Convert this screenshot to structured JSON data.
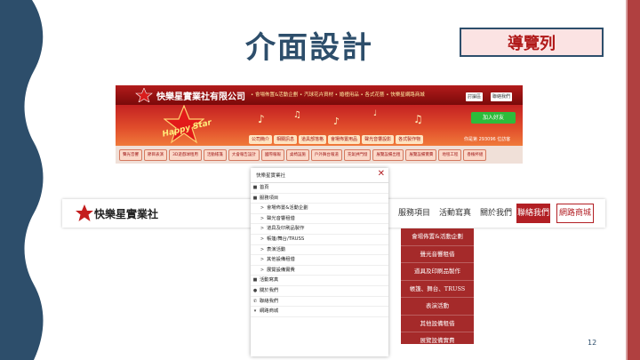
{
  "slide": {
    "title": "介面設計",
    "tag": "導覽列",
    "page_number": "12",
    "colors": {
      "title": "#2d4e6b",
      "accent": "#b21f24",
      "deco_blue": "#2d4e6b"
    }
  },
  "old_site": {
    "company_name": "快樂星實業社有限公司",
    "top_links": "• 會場佈置&活動企劃 • 汽球花卉資材 • 婚禮用品 • 各式花藝 • 快樂星網路商城",
    "top_buttons": [
      "討論區",
      "聯絡我們"
    ],
    "happy_star_text": "Happy Star",
    "line_button": "加入好友",
    "nav": [
      "公司簡介",
      "相關訊息",
      "道具部落格",
      "會場佈置用品",
      "聲光音響設影",
      "各式製作物"
    ],
    "visitor_count": "你是第 293096 位訪客",
    "tags": [
      "聲光音響",
      "節目表演",
      "3D遊戲球租用",
      "活動帳篷",
      "大會報告設計",
      "國際報報",
      "桌椅設施",
      "戶外舞台報道",
      "充氣拱門燈",
      "展覽設備出租",
      "展覽設備實費",
      "地毯工程",
      "香檳杯組"
    ]
  },
  "new_header": {
    "logo_text": "快樂星實業社",
    "nav": [
      "服務項目",
      "活動寫真",
      "關於我們"
    ],
    "contact": "聯絡我們",
    "shop": "網路商城"
  },
  "dropdown_items": [
    "會場佈置&活動企劃",
    "聲光音響租借",
    "道具及印刷品製作",
    "帳篷、舞台、TRUSS",
    "表演活動",
    "其他設備租借",
    "展覽設備實費"
  ],
  "mobile_menu": {
    "logo_text": "快樂星實業社",
    "close": "✕",
    "items": [
      {
        "icon": "■",
        "label": "首頁",
        "level": 0
      },
      {
        "icon": "■",
        "label": "服務項目",
        "level": 0
      },
      {
        "icon": ">",
        "label": "會場佈置&活動企劃",
        "level": 1
      },
      {
        "icon": ">",
        "label": "聲光音響租借",
        "level": 1
      },
      {
        "icon": ">",
        "label": "道具及印刷品製作",
        "level": 1
      },
      {
        "icon": ">",
        "label": "帳篷/舞台/TRUSS",
        "level": 1
      },
      {
        "icon": ">",
        "label": "表演活動",
        "level": 1
      },
      {
        "icon": ">",
        "label": "其他設備租借",
        "level": 1
      },
      {
        "icon": ">",
        "label": "展覽設備實費",
        "level": 1
      },
      {
        "icon": "■",
        "label": "活動寫真",
        "level": 0
      },
      {
        "icon": "●",
        "label": "關於我們",
        "level": 0
      },
      {
        "icon": "✆",
        "label": "聯絡我們",
        "level": 0
      },
      {
        "icon": "▾",
        "label": "網路商城",
        "level": 0
      }
    ]
  }
}
